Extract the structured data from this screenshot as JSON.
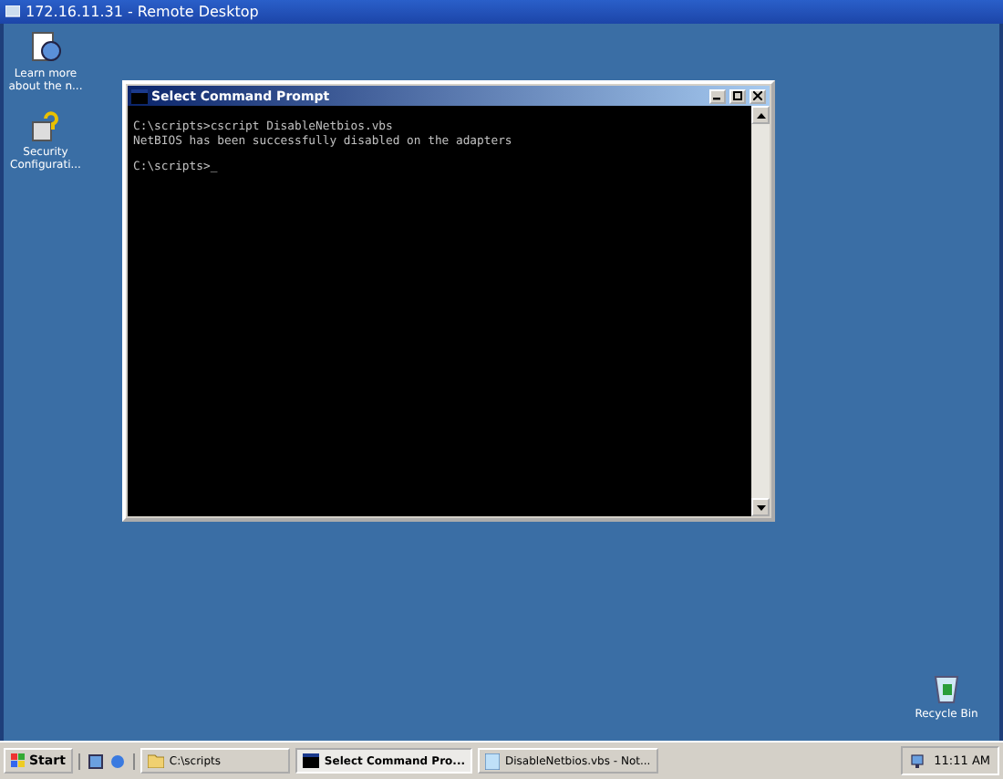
{
  "remote_window": {
    "title": "172.16.11.31 - Remote Desktop"
  },
  "desktop_icons": [
    {
      "label": "Learn more about the n...",
      "kind": "help"
    },
    {
      "label": "Security Configurati...",
      "kind": "security"
    },
    {
      "label": "Recycle Bin",
      "kind": "recycle"
    }
  ],
  "console": {
    "title": "Select Command Prompt",
    "blocks": [
      [
        "C:\\scripts>cscript DisableNetbios.vbs",
        "NetBIOS has been successfully disabled on the adapters"
      ],
      [
        "C:\\scripts>_"
      ]
    ]
  },
  "taskbar": {
    "start": "Start",
    "items": [
      {
        "label": "C:\\scripts",
        "kind": "folder",
        "selected": false
      },
      {
        "label": "Select Command Pro...",
        "kind": "console",
        "selected": true
      },
      {
        "label": "DisableNetbios.vbs - Not...",
        "kind": "notepad",
        "selected": false
      }
    ],
    "clock": "11:11 AM"
  }
}
